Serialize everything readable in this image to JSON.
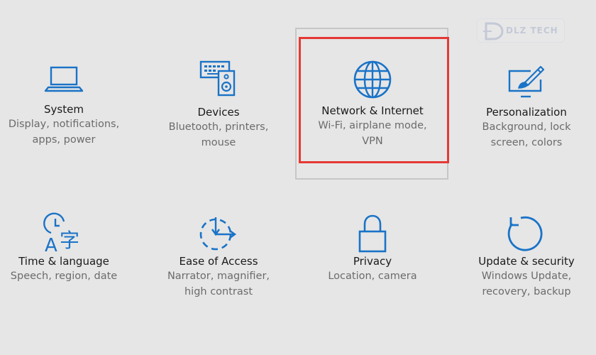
{
  "colors": {
    "background": "#e6e6e6",
    "icon": "#1a73c7",
    "title": "#1a1a1a",
    "description": "#6b6b6b",
    "highlight_box": "#e53935",
    "hover_outline": "#c6c6c6"
  },
  "watermark": {
    "text": "DLZ TECH"
  },
  "tiles": [
    {
      "id": "system",
      "icon": "laptop-icon",
      "title": "System",
      "description": "Display, notifications,\napps, power"
    },
    {
      "id": "devices",
      "icon": "devices-icon",
      "title": "Devices",
      "description": "Bluetooth, printers,\nmouse"
    },
    {
      "id": "network",
      "icon": "globe-icon",
      "title": "Network & Internet",
      "description": "Wi-Fi, airplane mode,\nVPN",
      "highlighted": true
    },
    {
      "id": "personalization",
      "icon": "paint-icon",
      "title": "Personalization",
      "description": "Background, lock\nscreen, colors"
    },
    {
      "id": "time",
      "icon": "time-language-icon",
      "title": "Time & language",
      "description": "Speech, region, date"
    },
    {
      "id": "ease",
      "icon": "ease-of-access-icon",
      "title": "Ease of Access",
      "description": "Narrator, magnifier,\nhigh contrast"
    },
    {
      "id": "privacy",
      "icon": "lock-icon",
      "title": "Privacy",
      "description": "Location, camera"
    },
    {
      "id": "update",
      "icon": "update-icon",
      "title": "Update & security",
      "description": "Windows Update,\nrecovery, backup"
    }
  ]
}
